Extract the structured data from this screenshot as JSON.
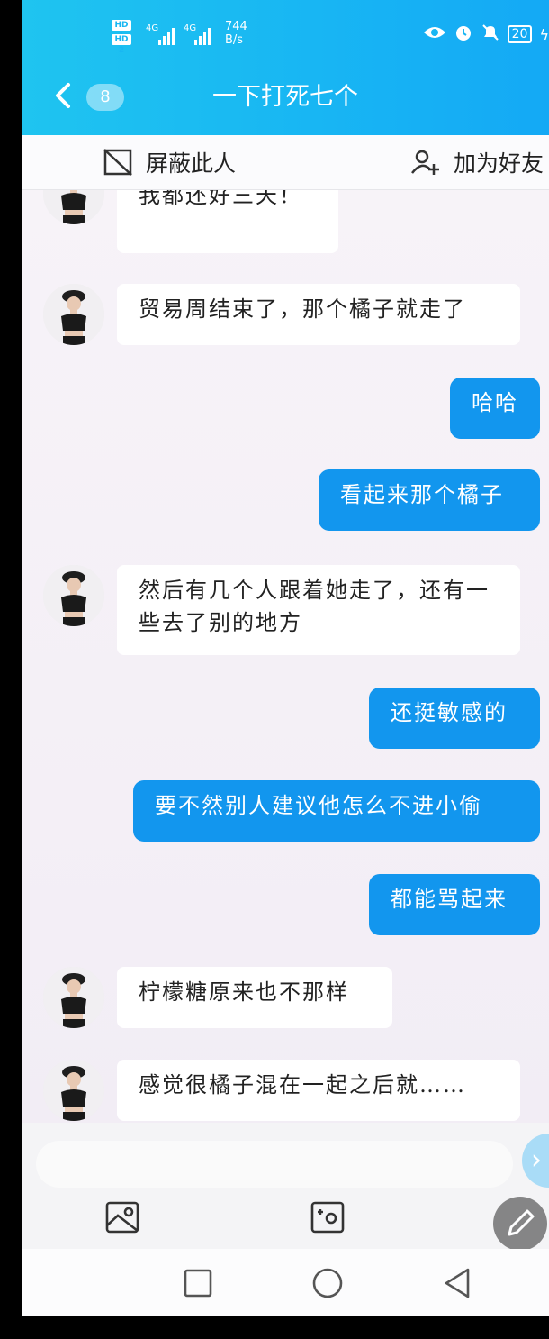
{
  "status_bar": {
    "hd1": "HD 1",
    "hd2": "HD 2",
    "net1": "4G",
    "net2": "4G",
    "speed_value": "744",
    "speed_unit": "B/s",
    "battery": "20",
    "icons": [
      "eye-icon",
      "alarm-icon",
      "mute-icon",
      "battery-icon",
      "charging-icon"
    ]
  },
  "header": {
    "back_icon": "chevron-left",
    "unread_count": "8",
    "title": "一下打死七个"
  },
  "actions": {
    "block_label": "屏蔽此人",
    "add_friend_label": "加为好友"
  },
  "messages": [
    {
      "side": "in",
      "text": "我都还好三天！"
    },
    {
      "side": "in",
      "text": "贸易周结束了，那个橘子就走了"
    },
    {
      "side": "out",
      "text": "哈哈"
    },
    {
      "side": "out",
      "text": "看起来那个橘子"
    },
    {
      "side": "in",
      "text": "然后有几个人跟着她走了，还有一些去了别的地方"
    },
    {
      "side": "out",
      "text": "还挺敏感的"
    },
    {
      "side": "out",
      "text": "要不然别人建议他怎么不进小偷"
    },
    {
      "side": "out",
      "text": "都能骂起来"
    },
    {
      "side": "in",
      "text": "柠檬糖原来也不那样"
    },
    {
      "side": "in",
      "text": "感觉很橘子混在一起之后就……"
    }
  ],
  "input": {
    "placeholder": ""
  },
  "toolbar": {
    "items": [
      "image-icon",
      "camera-icon",
      "pencil-icon"
    ]
  },
  "navbar": {
    "items": [
      "recent-apps-icon",
      "home-icon",
      "back-icon"
    ]
  },
  "colors": {
    "header": "#18b6f3",
    "bubble_out": "#1296ee",
    "bubble_in": "#ffffff",
    "background": "#f4eff6"
  }
}
